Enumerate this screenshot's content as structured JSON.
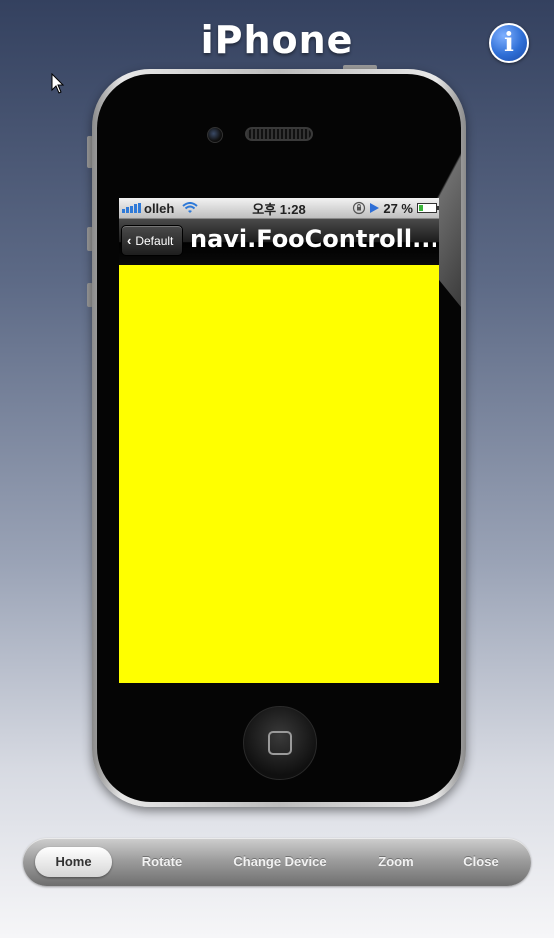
{
  "app": {
    "title": "iPhone",
    "info_label": "i"
  },
  "device": {
    "status_bar": {
      "carrier": "olleh",
      "time": "오후 1:28",
      "battery": "27 %",
      "battery_level": 0.27
    },
    "nav_bar": {
      "back_label": "Default",
      "back_chevron": "‹",
      "title": "navi.FooControll..."
    },
    "content": {
      "background_color": "#ffff00"
    }
  },
  "toolbar": {
    "items": [
      {
        "label": "Home",
        "selected": true
      },
      {
        "label": "Rotate",
        "selected": false
      },
      {
        "label": "Change Device",
        "selected": false
      },
      {
        "label": "Zoom",
        "selected": false
      },
      {
        "label": "Close",
        "selected": false
      }
    ]
  },
  "icons": {
    "info": "info-icon",
    "cursor": "mouse-cursor-icon",
    "signal": "signal-strength-icon",
    "wifi": "wifi-icon",
    "lock": "rotation-lock-icon",
    "play": "play-icon",
    "battery": "battery-icon",
    "home": "home-button-icon"
  }
}
